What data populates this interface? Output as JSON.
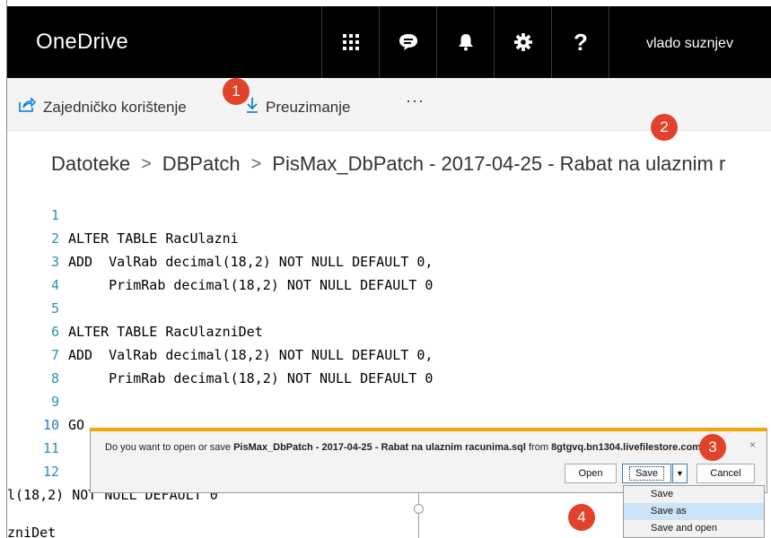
{
  "topbar": {
    "app_title": "OneDrive",
    "icons": [
      "app-launcher-icon",
      "chat-icon",
      "bell-icon",
      "gear-icon",
      "help-icon"
    ],
    "help_glyph": "?",
    "user_name": "vlado suznjev"
  },
  "commandbar": {
    "share_label": "Zajedničko korištenje",
    "download_label": "Preuzimanje",
    "more_label": "···"
  },
  "badges": [
    "1",
    "2",
    "3",
    "4"
  ],
  "breadcrumb": {
    "items": [
      "Datoteke",
      "DBPatch",
      "PisMax_DbPatch - 2017-04-25 - Rabat na ulaznim r"
    ],
    "separator": ">"
  },
  "code": {
    "lines": [
      {
        "n": "1",
        "text": ""
      },
      {
        "n": "2",
        "text": "ALTER TABLE RacUlazni"
      },
      {
        "n": "3",
        "text": "ADD  ValRab decimal(18,2) NOT NULL DEFAULT 0,"
      },
      {
        "n": "4",
        "text": "     PrimRab decimal(18,2) NOT NULL DEFAULT 0"
      },
      {
        "n": "5",
        "text": ""
      },
      {
        "n": "6",
        "text": "ALTER TABLE RacUlazniDet"
      },
      {
        "n": "7",
        "text": "ADD  ValRab decimal(18,2) NOT NULL DEFAULT 0,"
      },
      {
        "n": "8",
        "text": "     PrimRab decimal(18,2) NOT NULL DEFAULT 0"
      },
      {
        "n": "9",
        "text": ""
      },
      {
        "n": "10",
        "text": "GO"
      },
      {
        "n": "11",
        "text": ""
      },
      {
        "n": "12",
        "text": ""
      }
    ],
    "partial_behind_1": "l(18,2) NOT NULL DEFAULT 0",
    "partial_behind_2": "zniDet"
  },
  "download_bar": {
    "prefix": "Do you want to open or save ",
    "file_name": "PisMax_DbPatch - 2017-04-25 - Rabat na ulaznim racunima.sql",
    "middle": " from ",
    "source": "8gtgvq.bn1304.livefilestore.com",
    "suffix": "?",
    "close_glyph": "×",
    "open_label": "Open",
    "save_label": "Save",
    "dropdown_glyph": "▼",
    "cancel_label": "Cancel"
  },
  "save_menu": {
    "items": [
      "Save",
      "Save as",
      "Save and open"
    ],
    "highlighted": "Save as"
  },
  "colors": {
    "topbar_bg": "#000000",
    "accent": "#0078d7",
    "badge": "#e2422b",
    "line_number": "#2b91af",
    "notification_accent": "#f6a800",
    "menu_highlight": "#cce4f7"
  }
}
